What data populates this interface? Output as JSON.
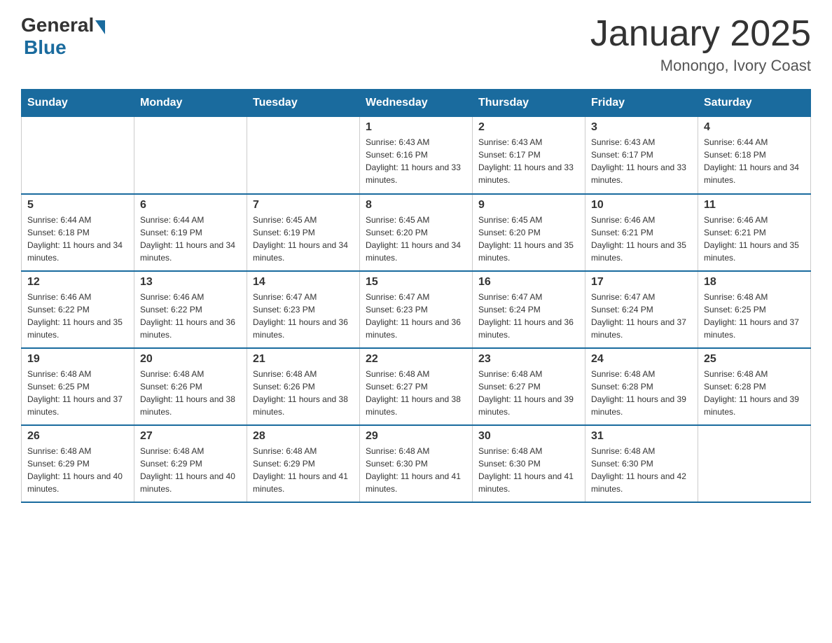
{
  "header": {
    "logo_general": "General",
    "logo_blue": "Blue",
    "title": "January 2025",
    "subtitle": "Monongo, Ivory Coast"
  },
  "days_of_week": [
    "Sunday",
    "Monday",
    "Tuesday",
    "Wednesday",
    "Thursday",
    "Friday",
    "Saturday"
  ],
  "weeks": [
    [
      {
        "day": "",
        "sunrise": "",
        "sunset": "",
        "daylight": ""
      },
      {
        "day": "",
        "sunrise": "",
        "sunset": "",
        "daylight": ""
      },
      {
        "day": "",
        "sunrise": "",
        "sunset": "",
        "daylight": ""
      },
      {
        "day": "1",
        "sunrise": "Sunrise: 6:43 AM",
        "sunset": "Sunset: 6:16 PM",
        "daylight": "Daylight: 11 hours and 33 minutes."
      },
      {
        "day": "2",
        "sunrise": "Sunrise: 6:43 AM",
        "sunset": "Sunset: 6:17 PM",
        "daylight": "Daylight: 11 hours and 33 minutes."
      },
      {
        "day": "3",
        "sunrise": "Sunrise: 6:43 AM",
        "sunset": "Sunset: 6:17 PM",
        "daylight": "Daylight: 11 hours and 33 minutes."
      },
      {
        "day": "4",
        "sunrise": "Sunrise: 6:44 AM",
        "sunset": "Sunset: 6:18 PM",
        "daylight": "Daylight: 11 hours and 34 minutes."
      }
    ],
    [
      {
        "day": "5",
        "sunrise": "Sunrise: 6:44 AM",
        "sunset": "Sunset: 6:18 PM",
        "daylight": "Daylight: 11 hours and 34 minutes."
      },
      {
        "day": "6",
        "sunrise": "Sunrise: 6:44 AM",
        "sunset": "Sunset: 6:19 PM",
        "daylight": "Daylight: 11 hours and 34 minutes."
      },
      {
        "day": "7",
        "sunrise": "Sunrise: 6:45 AM",
        "sunset": "Sunset: 6:19 PM",
        "daylight": "Daylight: 11 hours and 34 minutes."
      },
      {
        "day": "8",
        "sunrise": "Sunrise: 6:45 AM",
        "sunset": "Sunset: 6:20 PM",
        "daylight": "Daylight: 11 hours and 34 minutes."
      },
      {
        "day": "9",
        "sunrise": "Sunrise: 6:45 AM",
        "sunset": "Sunset: 6:20 PM",
        "daylight": "Daylight: 11 hours and 35 minutes."
      },
      {
        "day": "10",
        "sunrise": "Sunrise: 6:46 AM",
        "sunset": "Sunset: 6:21 PM",
        "daylight": "Daylight: 11 hours and 35 minutes."
      },
      {
        "day": "11",
        "sunrise": "Sunrise: 6:46 AM",
        "sunset": "Sunset: 6:21 PM",
        "daylight": "Daylight: 11 hours and 35 minutes."
      }
    ],
    [
      {
        "day": "12",
        "sunrise": "Sunrise: 6:46 AM",
        "sunset": "Sunset: 6:22 PM",
        "daylight": "Daylight: 11 hours and 35 minutes."
      },
      {
        "day": "13",
        "sunrise": "Sunrise: 6:46 AM",
        "sunset": "Sunset: 6:22 PM",
        "daylight": "Daylight: 11 hours and 36 minutes."
      },
      {
        "day": "14",
        "sunrise": "Sunrise: 6:47 AM",
        "sunset": "Sunset: 6:23 PM",
        "daylight": "Daylight: 11 hours and 36 minutes."
      },
      {
        "day": "15",
        "sunrise": "Sunrise: 6:47 AM",
        "sunset": "Sunset: 6:23 PM",
        "daylight": "Daylight: 11 hours and 36 minutes."
      },
      {
        "day": "16",
        "sunrise": "Sunrise: 6:47 AM",
        "sunset": "Sunset: 6:24 PM",
        "daylight": "Daylight: 11 hours and 36 minutes."
      },
      {
        "day": "17",
        "sunrise": "Sunrise: 6:47 AM",
        "sunset": "Sunset: 6:24 PM",
        "daylight": "Daylight: 11 hours and 37 minutes."
      },
      {
        "day": "18",
        "sunrise": "Sunrise: 6:48 AM",
        "sunset": "Sunset: 6:25 PM",
        "daylight": "Daylight: 11 hours and 37 minutes."
      }
    ],
    [
      {
        "day": "19",
        "sunrise": "Sunrise: 6:48 AM",
        "sunset": "Sunset: 6:25 PM",
        "daylight": "Daylight: 11 hours and 37 minutes."
      },
      {
        "day": "20",
        "sunrise": "Sunrise: 6:48 AM",
        "sunset": "Sunset: 6:26 PM",
        "daylight": "Daylight: 11 hours and 38 minutes."
      },
      {
        "day": "21",
        "sunrise": "Sunrise: 6:48 AM",
        "sunset": "Sunset: 6:26 PM",
        "daylight": "Daylight: 11 hours and 38 minutes."
      },
      {
        "day": "22",
        "sunrise": "Sunrise: 6:48 AM",
        "sunset": "Sunset: 6:27 PM",
        "daylight": "Daylight: 11 hours and 38 minutes."
      },
      {
        "day": "23",
        "sunrise": "Sunrise: 6:48 AM",
        "sunset": "Sunset: 6:27 PM",
        "daylight": "Daylight: 11 hours and 39 minutes."
      },
      {
        "day": "24",
        "sunrise": "Sunrise: 6:48 AM",
        "sunset": "Sunset: 6:28 PM",
        "daylight": "Daylight: 11 hours and 39 minutes."
      },
      {
        "day": "25",
        "sunrise": "Sunrise: 6:48 AM",
        "sunset": "Sunset: 6:28 PM",
        "daylight": "Daylight: 11 hours and 39 minutes."
      }
    ],
    [
      {
        "day": "26",
        "sunrise": "Sunrise: 6:48 AM",
        "sunset": "Sunset: 6:29 PM",
        "daylight": "Daylight: 11 hours and 40 minutes."
      },
      {
        "day": "27",
        "sunrise": "Sunrise: 6:48 AM",
        "sunset": "Sunset: 6:29 PM",
        "daylight": "Daylight: 11 hours and 40 minutes."
      },
      {
        "day": "28",
        "sunrise": "Sunrise: 6:48 AM",
        "sunset": "Sunset: 6:29 PM",
        "daylight": "Daylight: 11 hours and 41 minutes."
      },
      {
        "day": "29",
        "sunrise": "Sunrise: 6:48 AM",
        "sunset": "Sunset: 6:30 PM",
        "daylight": "Daylight: 11 hours and 41 minutes."
      },
      {
        "day": "30",
        "sunrise": "Sunrise: 6:48 AM",
        "sunset": "Sunset: 6:30 PM",
        "daylight": "Daylight: 11 hours and 41 minutes."
      },
      {
        "day": "31",
        "sunrise": "Sunrise: 6:48 AM",
        "sunset": "Sunset: 6:30 PM",
        "daylight": "Daylight: 11 hours and 42 minutes."
      },
      {
        "day": "",
        "sunrise": "",
        "sunset": "",
        "daylight": ""
      }
    ]
  ]
}
